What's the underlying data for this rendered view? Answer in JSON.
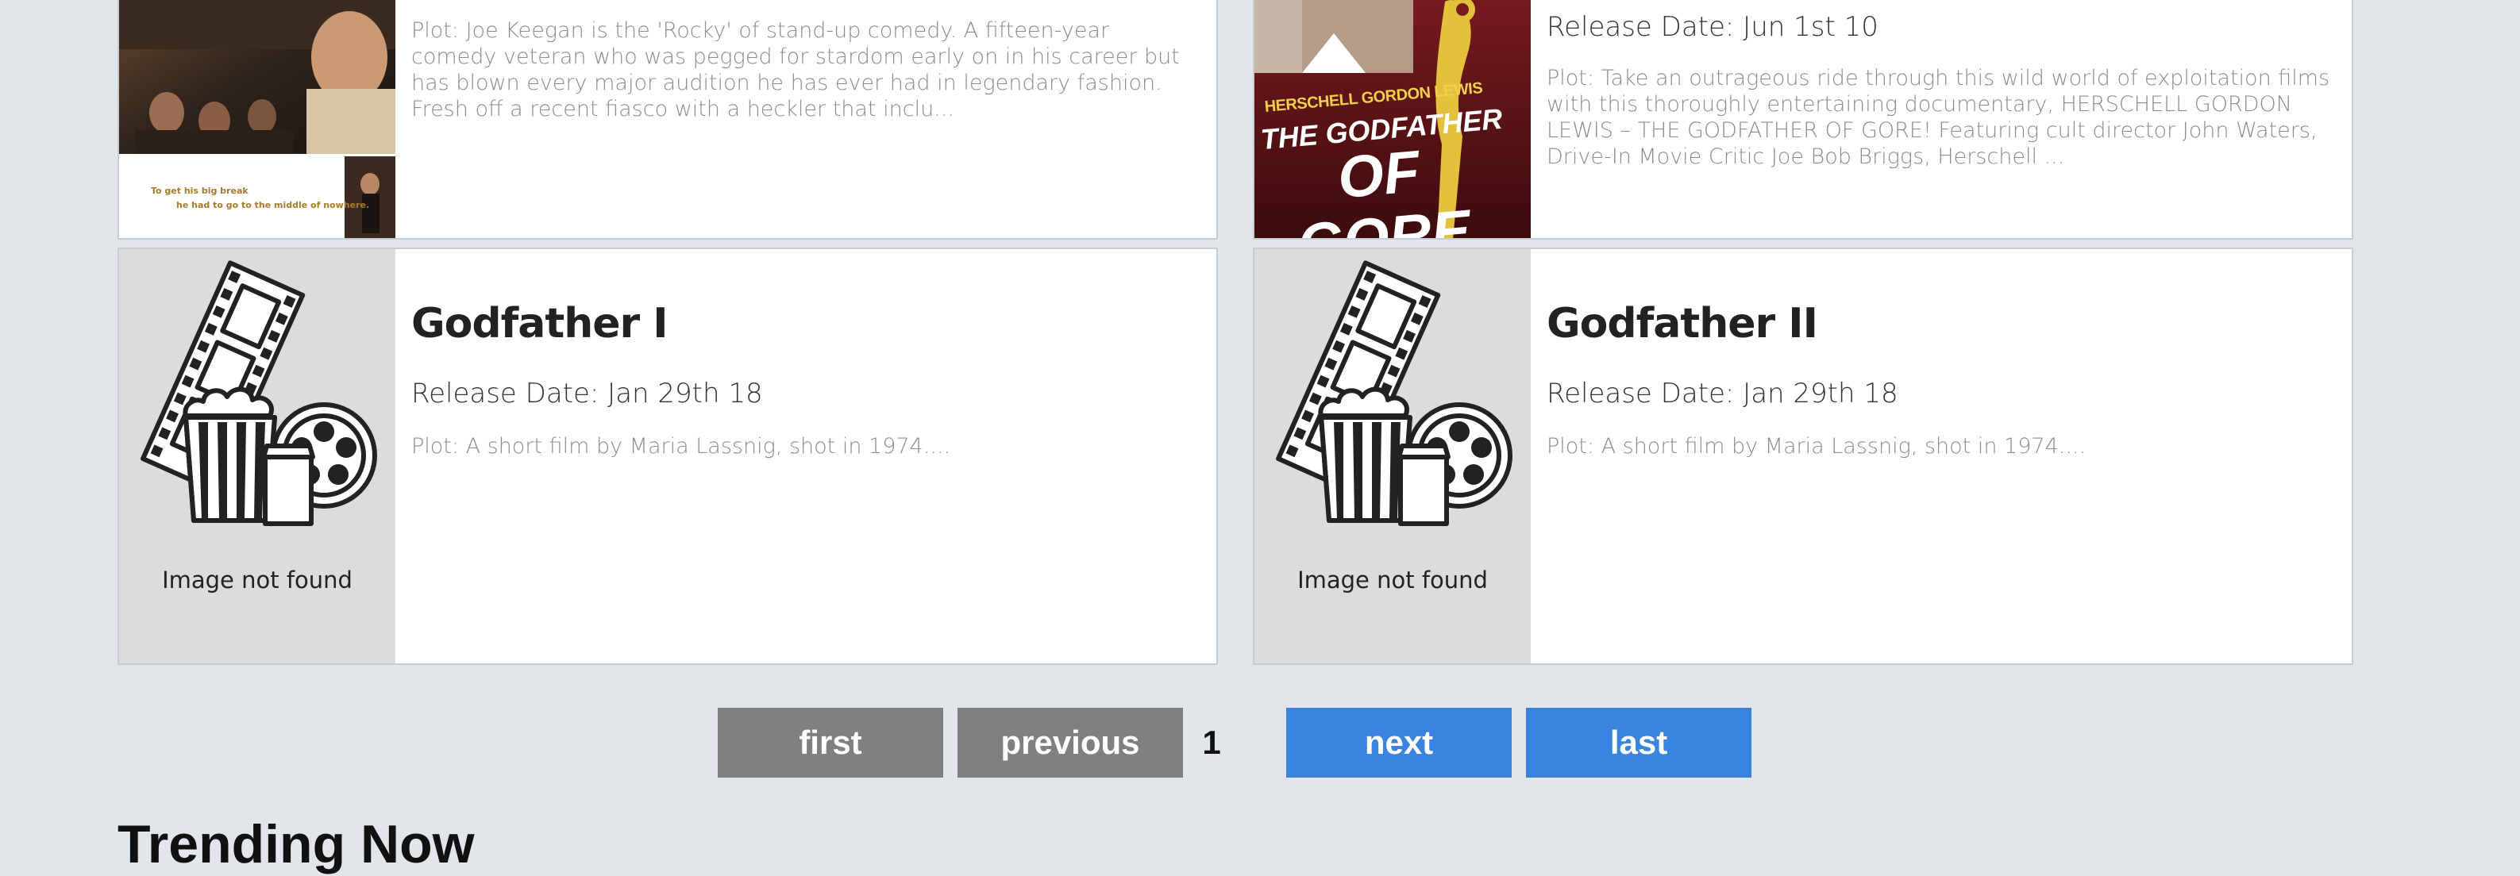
{
  "movies_top": [
    {
      "plot": "Plot: Joe Keegan is the 'Rocky' of stand-up comedy. A fifteen-year comedy veteran who was pegged for stardom early on in his career but has blown every major audition he has ever had in legendary fashion. Fresh off a recent fiasco with a heckler that inclu...",
      "poster_caption_line1": "To get his big break",
      "poster_caption_line2": "he had to go to the middle of nowhere."
    },
    {
      "release": "Release Date: Jun 1st 10",
      "plot": "Plot: Take an outrageous ride through this wild world of exploitation films with this thoroughly entertaining documentary, HERSCHELL GORDON LEWIS – THE GODFATHER OF GORE! Featuring cult director John Waters, Drive-In Movie Critic Joe Bob Briggs, Herschell ...",
      "poster_name": "HERSCHELL GORDON LEWIS",
      "poster_title_line1": "THE GODFATHER",
      "poster_title_line2": "OF GORE"
    }
  ],
  "movies": [
    {
      "title": "Godfather I",
      "release": "Release Date: Jan 29th 18",
      "plot": "Plot: A short film by Maria Lassnig, shot in 1974....",
      "image_placeholder": "Image not found"
    },
    {
      "title": "Godfather II",
      "release": "Release Date: Jan 29th 18",
      "plot": "Plot: A short film by Maria Lassnig, shot in 1974....",
      "image_placeholder": "Image not found"
    }
  ],
  "pagination": {
    "first": "first",
    "previous": "previous",
    "current_page": "1",
    "next": "next",
    "last": "last",
    "disabled_color": "#808080",
    "active_color": "#3a83de"
  },
  "sections": {
    "trending_title": "Trending Now"
  },
  "icons": {
    "placeholder": "film-popcorn-icon"
  }
}
